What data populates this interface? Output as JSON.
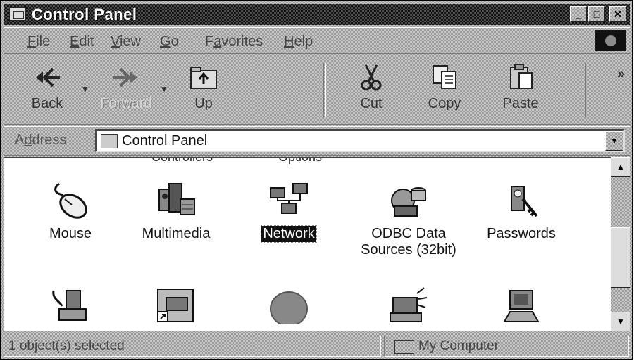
{
  "window": {
    "title": "Control Panel",
    "controls": {
      "minimize": "_",
      "maximize": "□",
      "close": "✕"
    }
  },
  "menu": [
    {
      "label": "File",
      "accel": "F"
    },
    {
      "label": "Edit",
      "accel": "E"
    },
    {
      "label": "View",
      "accel": "V"
    },
    {
      "label": "Go",
      "accel": "G"
    },
    {
      "label": "Favorites",
      "accel": "a"
    },
    {
      "label": "Help",
      "accel": "H"
    }
  ],
  "toolbar": {
    "back": "Back",
    "forward": "Forward",
    "up": "Up",
    "cut": "Cut",
    "copy": "Copy",
    "paste": "Paste",
    "more": "»"
  },
  "address": {
    "label": "Address",
    "value": "Control Panel"
  },
  "content": {
    "partial_labels": [
      "Controllers",
      "Options"
    ],
    "row1": [
      {
        "name": "Mouse",
        "icon": "mouse-icon"
      },
      {
        "name": "Multimedia",
        "icon": "multimedia-icon"
      },
      {
        "name": "Network",
        "icon": "network-icon",
        "selected": true
      },
      {
        "name": "ODBC Data Sources (32bit)",
        "name_line1": "ODBC Data",
        "name_line2": "Sources (32bit)",
        "icon": "odbc-icon"
      },
      {
        "name": "Passwords",
        "icon": "passwords-icon"
      }
    ],
    "row2_icons": [
      "power-management-icon",
      "printers-shortcut-icon",
      "regional-settings-icon",
      "sounds-icon",
      "system-icon"
    ]
  },
  "status": {
    "selection": "1 object(s) selected",
    "zone": "My Computer"
  }
}
